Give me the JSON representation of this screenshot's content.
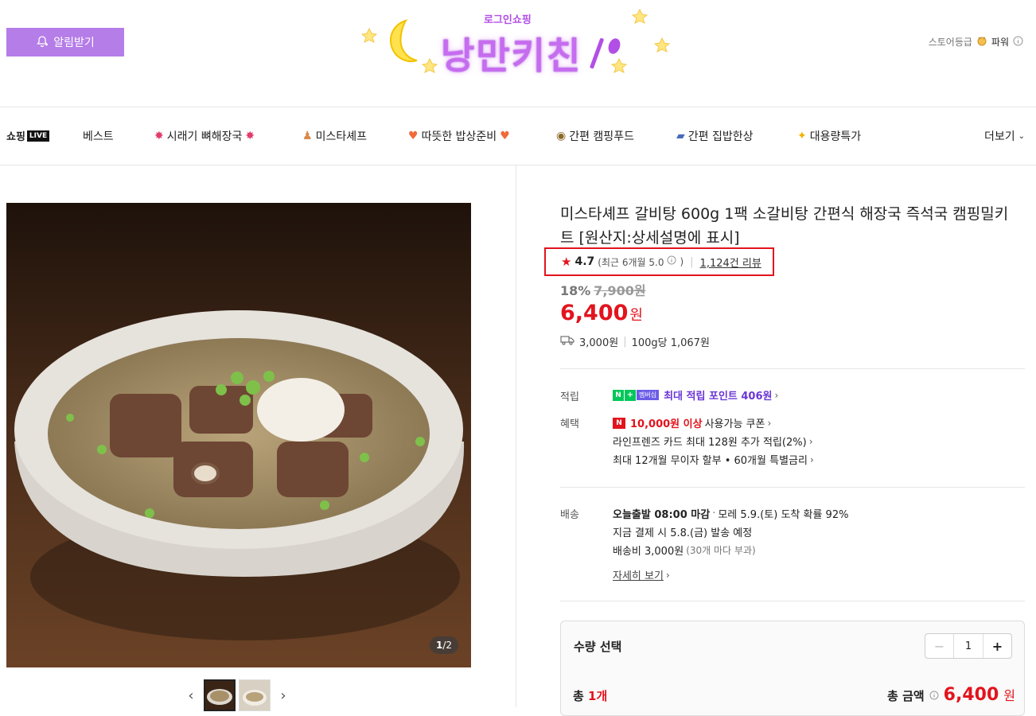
{
  "header": {
    "notify_label": "알림받기",
    "logo_small": "로그인쇼핑",
    "logo_main": "낭만키친",
    "store_grade_label": "스토어등급",
    "store_grade_value": "파워"
  },
  "nav": {
    "live_label": "쇼핑",
    "live_tag": "LIVE",
    "items": [
      {
        "label": "베스트"
      },
      {
        "label": "시래기 뼈해장국"
      },
      {
        "label": "미스타셰프"
      },
      {
        "label": "따뜻한 밥상준비"
      },
      {
        "label": "간편 캠핑푸드"
      },
      {
        "label": "간편 집밥한상"
      },
      {
        "label": "대용량특가"
      }
    ],
    "more_label": "더보기"
  },
  "gallery": {
    "counter_current": "1",
    "counter_total": "/2"
  },
  "product": {
    "title": "미스타셰프 갈비탕 600g 1팩 소갈비탕 간편식 해장국 즉석국 캠핑밀키트 [원산지:상세설명에 표시]",
    "rating": "4.7",
    "recent_rating": "(최근 6개월 5.0",
    "recent_close": ")",
    "review_count": "1,124건 리뷰",
    "discount_rate": "18%",
    "original_price": "7,900원",
    "price": "6,400",
    "price_unit": "원",
    "shipping_fee": "3,000원",
    "unit_price": "100g당 1,067원"
  },
  "benefits": {
    "points_label": "적립",
    "points_membership_tag": "멤버십",
    "points_text": "최대 적립 포인트 406원",
    "benefit_label": "혜택",
    "coupon_highlight": "10,000원 이상",
    "coupon_text": "사용가능 쿠폰",
    "card_text": "라인프렌즈 카드 최대 128원 추가 적립(2%)",
    "installment_text": "최대 12개월 무이자 할부 • 60개월 특별금리"
  },
  "delivery": {
    "label": "배송",
    "cutoff": "오늘출발 08:00 마감",
    "dot": "·",
    "arrival": "모레 5.9.(토) 도착 확률 92%",
    "dispatch": "지금 결제 시 5.8.(금) 발송 예정",
    "fee": "배송비 3,000원",
    "fee_note": "(30개 마다 부과)",
    "detail_link": "자세히 보기"
  },
  "purchase": {
    "qty_label": "수량 선택",
    "qty_value": "1",
    "total_count_prefix": "총 ",
    "total_count": "1개",
    "total_label": "총 금액",
    "total_price": "6,400",
    "total_unit": "원"
  },
  "colors": {
    "accent_red": "#e2141d",
    "notify_purple": "#b57de8",
    "points_purple": "#6b36d6",
    "naver_green": "#03c75a"
  }
}
